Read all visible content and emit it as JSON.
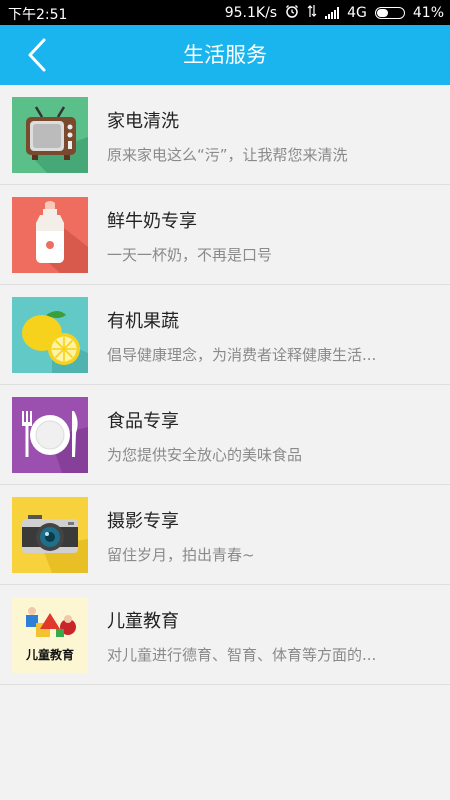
{
  "status_bar": {
    "time": "下午2:51",
    "network_speed": "95.1K/s",
    "network_type": "4G",
    "battery": "41%",
    "icons": [
      "alarm-icon",
      "data-arrows-icon",
      "signal-icon",
      "battery-icon"
    ]
  },
  "header": {
    "title": "生活服务",
    "back_icon": "chevron-left-icon",
    "background": "#1ab5ee"
  },
  "services": [
    {
      "title": "家电清洗",
      "subtitle": "原来家电这么“污”，让我帮您来清洗",
      "icon": "tv-icon",
      "color": "#5bbf8a"
    },
    {
      "title": "鲜牛奶专享",
      "subtitle": "一天一杯奶，不再是口号",
      "icon": "milk-bottle-icon",
      "color": "#ee6d5f"
    },
    {
      "title": "有机果蔬",
      "subtitle": "倡导健康理念，为消费者诠释健康生活...",
      "icon": "lemon-icon",
      "color": "#62c9c6"
    },
    {
      "title": "食品专享",
      "subtitle": "为您提供安全放心的美味食品",
      "icon": "plate-cutlery-icon",
      "color": "#9b4fae"
    },
    {
      "title": "摄影专享",
      "subtitle": "留住岁月，拍出青春~",
      "icon": "camera-icon",
      "color": "#f7d23c"
    },
    {
      "title": "儿童教育",
      "subtitle": "对儿童进行德育、智育、体育等方面的...",
      "icon": "kids-education-icon",
      "color": "#fdf6d3",
      "logo_text": "儿童教育"
    }
  ]
}
